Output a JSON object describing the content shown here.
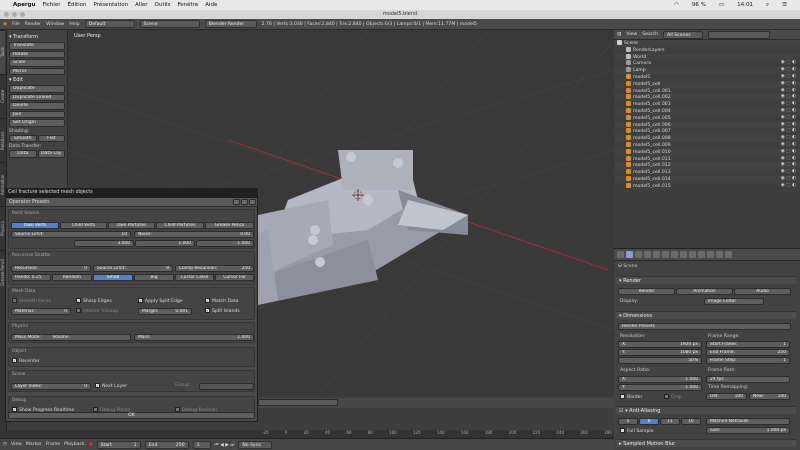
{
  "mac_menu": {
    "apple": "",
    "app": "Apergu",
    "items": [
      "Fichier",
      "Édition",
      "Présentation",
      "Aller",
      "Outils",
      "Fenêtre",
      "Aide"
    ],
    "battery": "96 %",
    "time": "14:01"
  },
  "window_title": "model5.blend",
  "info_header": {
    "menus": [
      "File",
      "Render",
      "Window",
      "Help"
    ],
    "layout": "Default",
    "scene": "Scene",
    "engine": "Blender Render",
    "stats": "2.76 | Verts:3,038 | Faces:2,840 | Tris:2,840 | Objects:0/3 | Lamps:0/1 | Mem:11.77M | model5"
  },
  "tool_tabs": [
    "Tools",
    "Create",
    "Relations",
    "Animation",
    "Physics",
    "Grease Pencil"
  ],
  "toolshelf": {
    "transform_title": "▾ Transform",
    "transform": [
      "Translate",
      "Rotate",
      "Scale",
      "Mirror"
    ],
    "edit_title": "▾ Edit",
    "edit": [
      "Duplicate",
      "Duplicate Linked",
      "Delete",
      "Join",
      "Set Origin"
    ],
    "shading_label": "Shading:",
    "shading": [
      "Smooth",
      "Flat"
    ],
    "data_transfer_label": "Data Transfer:",
    "data_transfer": [
      "Data",
      "Data Lay"
    ]
  },
  "viewport": {
    "label": "User Persp"
  },
  "operator": {
    "caption": "Cell fracture selected mesh objects",
    "title": "Operator Presets",
    "point_source_header": "Point Source",
    "point_source": [
      "Own Verts",
      "Child Verts",
      "Own Particles",
      "Child Particles",
      "Grease Pencil"
    ],
    "source_limit_label": "Source Limit:",
    "source_limit": "10",
    "noise_label": "Noise:",
    "noise": "0.00",
    "scale_values": [
      "3.000",
      "1.000",
      "1.000"
    ],
    "recursive_header": "Recursive Shatter",
    "recursion_label": "Recursion:",
    "recursion": "0",
    "src_limit_label": "Source Limit:",
    "src_limit": "8",
    "clamp_label": "Clamp Recursion:",
    "clamp": "250",
    "random_label": "Rando: 0.25",
    "recursion_modes": [
      "Random",
      "Small",
      "Big",
      "Cursor Close",
      "Cursor Far"
    ],
    "mesh_header": "Mesh Data",
    "smooth_faces": "Smooth Faces",
    "sharp_edges": "Sharp Edges",
    "apply_split": "Apply Split Edge",
    "match_data": "Match Data",
    "material_label": "Material:",
    "material": "0",
    "interior_vgroup": "Interior VGroup",
    "margin_label": "Margin:",
    "margin": "0.001",
    "split_islands": "Split Islands",
    "physics_header": "Physics",
    "mass_mode_label": "Mass Mode:",
    "mass_mode": "Volume",
    "mass_label": "Mass:",
    "mass": "1.000",
    "object_header": "Object",
    "recenter": "Recenter",
    "scene_header": "Scene",
    "layer_index_label": "Layer Index:",
    "layer_index": "0",
    "next_layer": "Next Layer",
    "group_label": "Group:",
    "debug_header": "Debug",
    "show_progress": "Show Progress Realtime",
    "debug_points": "Debug Points",
    "debug_boolean": "Debug Boolean",
    "ok": "OK"
  },
  "timeline": {
    "menus": [
      "View",
      "Marker",
      "Frame",
      "Playback"
    ],
    "start_label": "Start",
    "start": "1",
    "end_label": "End",
    "end": "250",
    "current": "1",
    "sync": "No Sync",
    "ticks": [
      "-20",
      "0",
      "20",
      "40",
      "60",
      "80",
      "100",
      "120",
      "140",
      "160",
      "180",
      "200",
      "220",
      "240",
      "260",
      "280"
    ]
  },
  "outliner": {
    "menus": [
      "View",
      "Search",
      "All Scenes"
    ],
    "items": [
      "Scene",
      "RenderLayers",
      "World",
      "Camera",
      "Lamp",
      "model5",
      "model5_cell",
      "model5_cell.001",
      "model5_cell.002",
      "model5_cell.003",
      "model5_cell.004",
      "model5_cell.005",
      "model5_cell.006",
      "model5_cell.007",
      "model5_cell.008",
      "model5_cell.009",
      "model5_cell.010",
      "model5_cell.011",
      "model5_cell.012",
      "model5_cell.013",
      "model5_cell.014",
      "model5_cell.015"
    ]
  },
  "properties": {
    "scene_label": "Scene",
    "render_title": "▾ Render",
    "render_buttons": [
      "Render",
      "Animation",
      "Audio"
    ],
    "display_label": "Display:",
    "display": "Image Editor",
    "dimensions_title": "▾ Dimensions",
    "render_presets": "Render Presets",
    "resolution_label": "Resolution:",
    "res_x_label": "X:",
    "res_x": "1920 px",
    "res_y_label": "Y:",
    "res_y": "1080 px",
    "res_pct": "50%",
    "frame_range_label": "Frame Range:",
    "start_frame_label": "Start Frame:",
    "start_frame": "1",
    "end_frame_label": "End Frame:",
    "end_frame": "250",
    "frame_step_label": "Frame Step:",
    "frame_step": "1",
    "aspect_label": "Aspect Ratio:",
    "asp_x_label": "X:",
    "asp_x": "1.000",
    "asp_y_label": "Y:",
    "asp_y": "1.000",
    "frame_rate_label": "Frame Rate:",
    "frame_rate": "24 fps",
    "time_remap_label": "Time Remapping:",
    "old_label": "Old:",
    "old": "100",
    "new_label": "New:",
    "new": "100",
    "border": "Border",
    "crop": "Crop",
    "aa_title": "▾ Anti-Aliasing",
    "aa_samples": [
      "5",
      "8",
      "11",
      "16"
    ],
    "filter": "Mitchell-Netravali",
    "full_sample": "Full Sample",
    "size_label": "Size:",
    "size": "1.000 px",
    "motion_blur": "▸ Sampled Motion Blur"
  }
}
